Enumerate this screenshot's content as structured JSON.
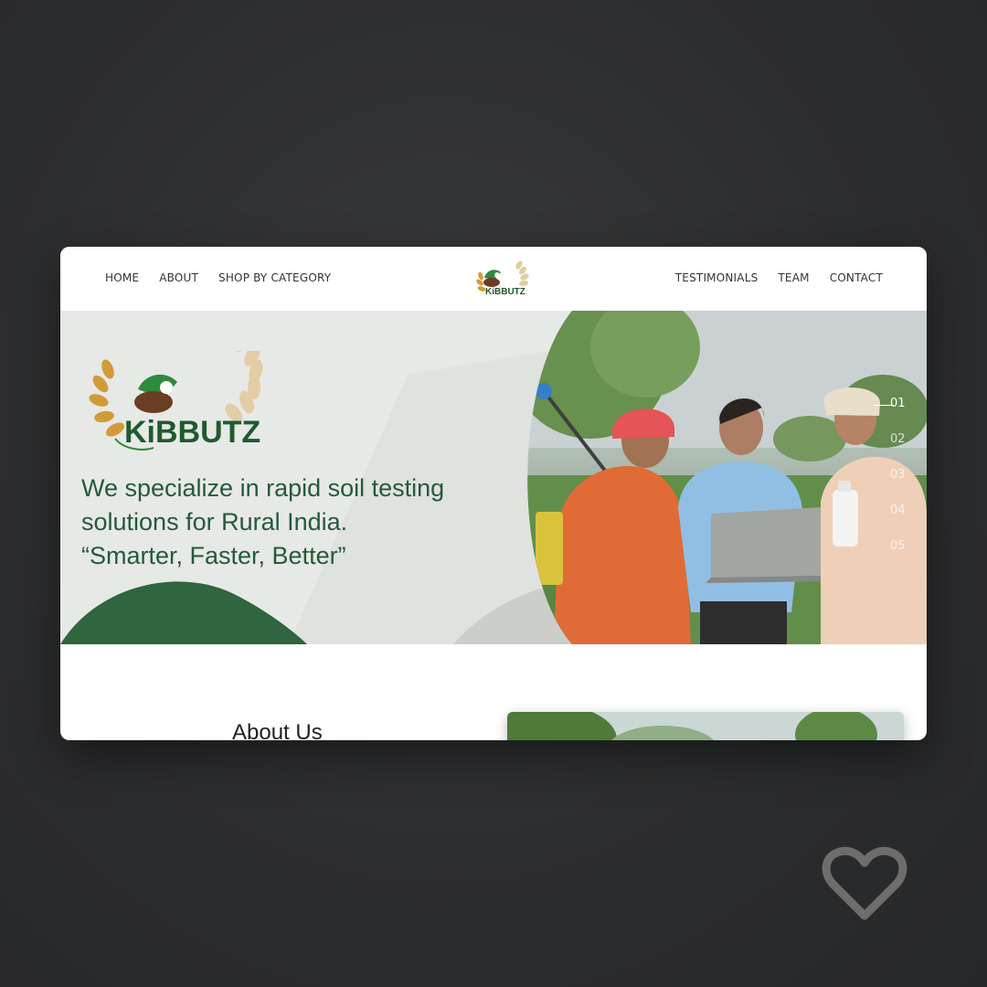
{
  "nav": {
    "left_items": [
      "HOME",
      "ABOUT",
      "SHOP BY CATEGORY"
    ],
    "right_items": [
      "TESTIMONIALS",
      "TEAM",
      "CONTACT"
    ],
    "logo_text": "KiBBUTZ"
  },
  "hero": {
    "logo_text": "KiBBUTZ",
    "line1": "We specialize in rapid soil testing",
    "line2": "solutions for Rural India.",
    "tagline": "“Smarter, Faster, Better”",
    "slides": [
      "01",
      "02",
      "03",
      "04",
      "05"
    ],
    "active_slide": "01"
  },
  "about": {
    "title": "About Us"
  },
  "colors": {
    "brand_green": "#255a3a",
    "dark_green": "#1f5a2e",
    "gold": "#d29b3a",
    "brown": "#6b3d22",
    "backdrop": "#2c2d2f"
  },
  "icons": {
    "like": "heart-outline-icon"
  }
}
